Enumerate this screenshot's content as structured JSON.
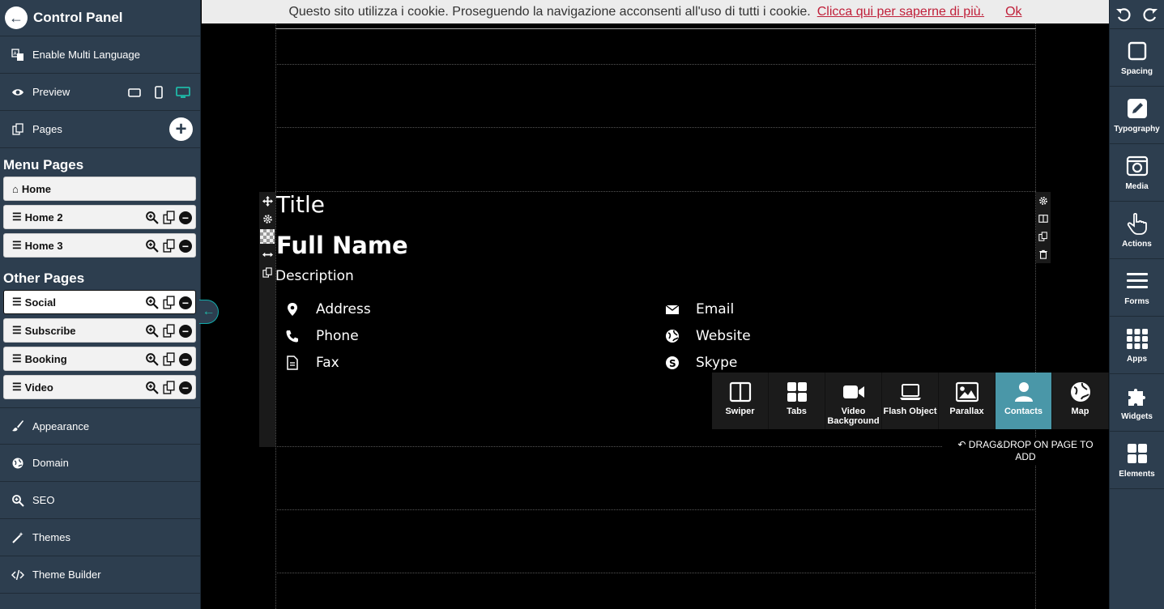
{
  "sidebar": {
    "title": "Control Panel",
    "multi_language": "Enable Multi Language",
    "preview": "Preview",
    "pages": "Pages",
    "menu_pages_title": "Menu Pages",
    "menu_pages": [
      {
        "label": "Home"
      },
      {
        "label": "Home 2"
      },
      {
        "label": "Home 3"
      }
    ],
    "other_pages_title": "Other Pages",
    "other_pages": [
      {
        "label": "Social"
      },
      {
        "label": "Subscribe"
      },
      {
        "label": "Booking"
      },
      {
        "label": "Video"
      }
    ],
    "bottom": [
      {
        "label": "Appearance",
        "icon": "brush-icon"
      },
      {
        "label": "Domain",
        "icon": "globe-icon"
      },
      {
        "label": "SEO",
        "icon": "search-plus-icon"
      },
      {
        "label": "Themes",
        "icon": "magic-wand-icon"
      },
      {
        "label": "Theme Builder",
        "icon": "code-icon"
      }
    ]
  },
  "cookie": {
    "text": "Questo sito utilizza i cookie. Proseguendo la navigazione acconsenti all'uso di tutti i cookie.",
    "link": "Clicca qui per saperne di più.",
    "ok": "Ok"
  },
  "content": {
    "title": "Title",
    "full_name": "Full Name",
    "description": "Description",
    "contacts_left": [
      "Address",
      "Phone",
      "Fax"
    ],
    "contacts_right": [
      "Email",
      "Website",
      "Skype"
    ]
  },
  "elements_panel": {
    "items": [
      {
        "label": "Swiper",
        "line2": ""
      },
      {
        "label": "Tabs",
        "line2": ""
      },
      {
        "label": "Video",
        "line2": "Background"
      },
      {
        "label": "Flash Object",
        "line2": ""
      },
      {
        "label": "Parallax",
        "line2": ""
      },
      {
        "label": "Contacts",
        "line2": ""
      },
      {
        "label": "Map",
        "line2": ""
      }
    ],
    "active": "Contacts",
    "active_color": "#4a97a8",
    "drag_hint_line1": "DRAG&DROP ON PAGE TO",
    "drag_hint_line2": "ADD"
  },
  "right_toolbar": {
    "items": [
      {
        "label": "Spacing"
      },
      {
        "label": "Typography"
      },
      {
        "label": "Media"
      },
      {
        "label": "Actions"
      },
      {
        "label": "Forms"
      },
      {
        "label": "Apps"
      },
      {
        "label": "Widgets"
      },
      {
        "label": "Elements"
      }
    ]
  },
  "colors": {
    "panel_bg": "#2d3e4f",
    "accent": "#1fb7a6",
    "cookie_link": "#c0203a"
  }
}
